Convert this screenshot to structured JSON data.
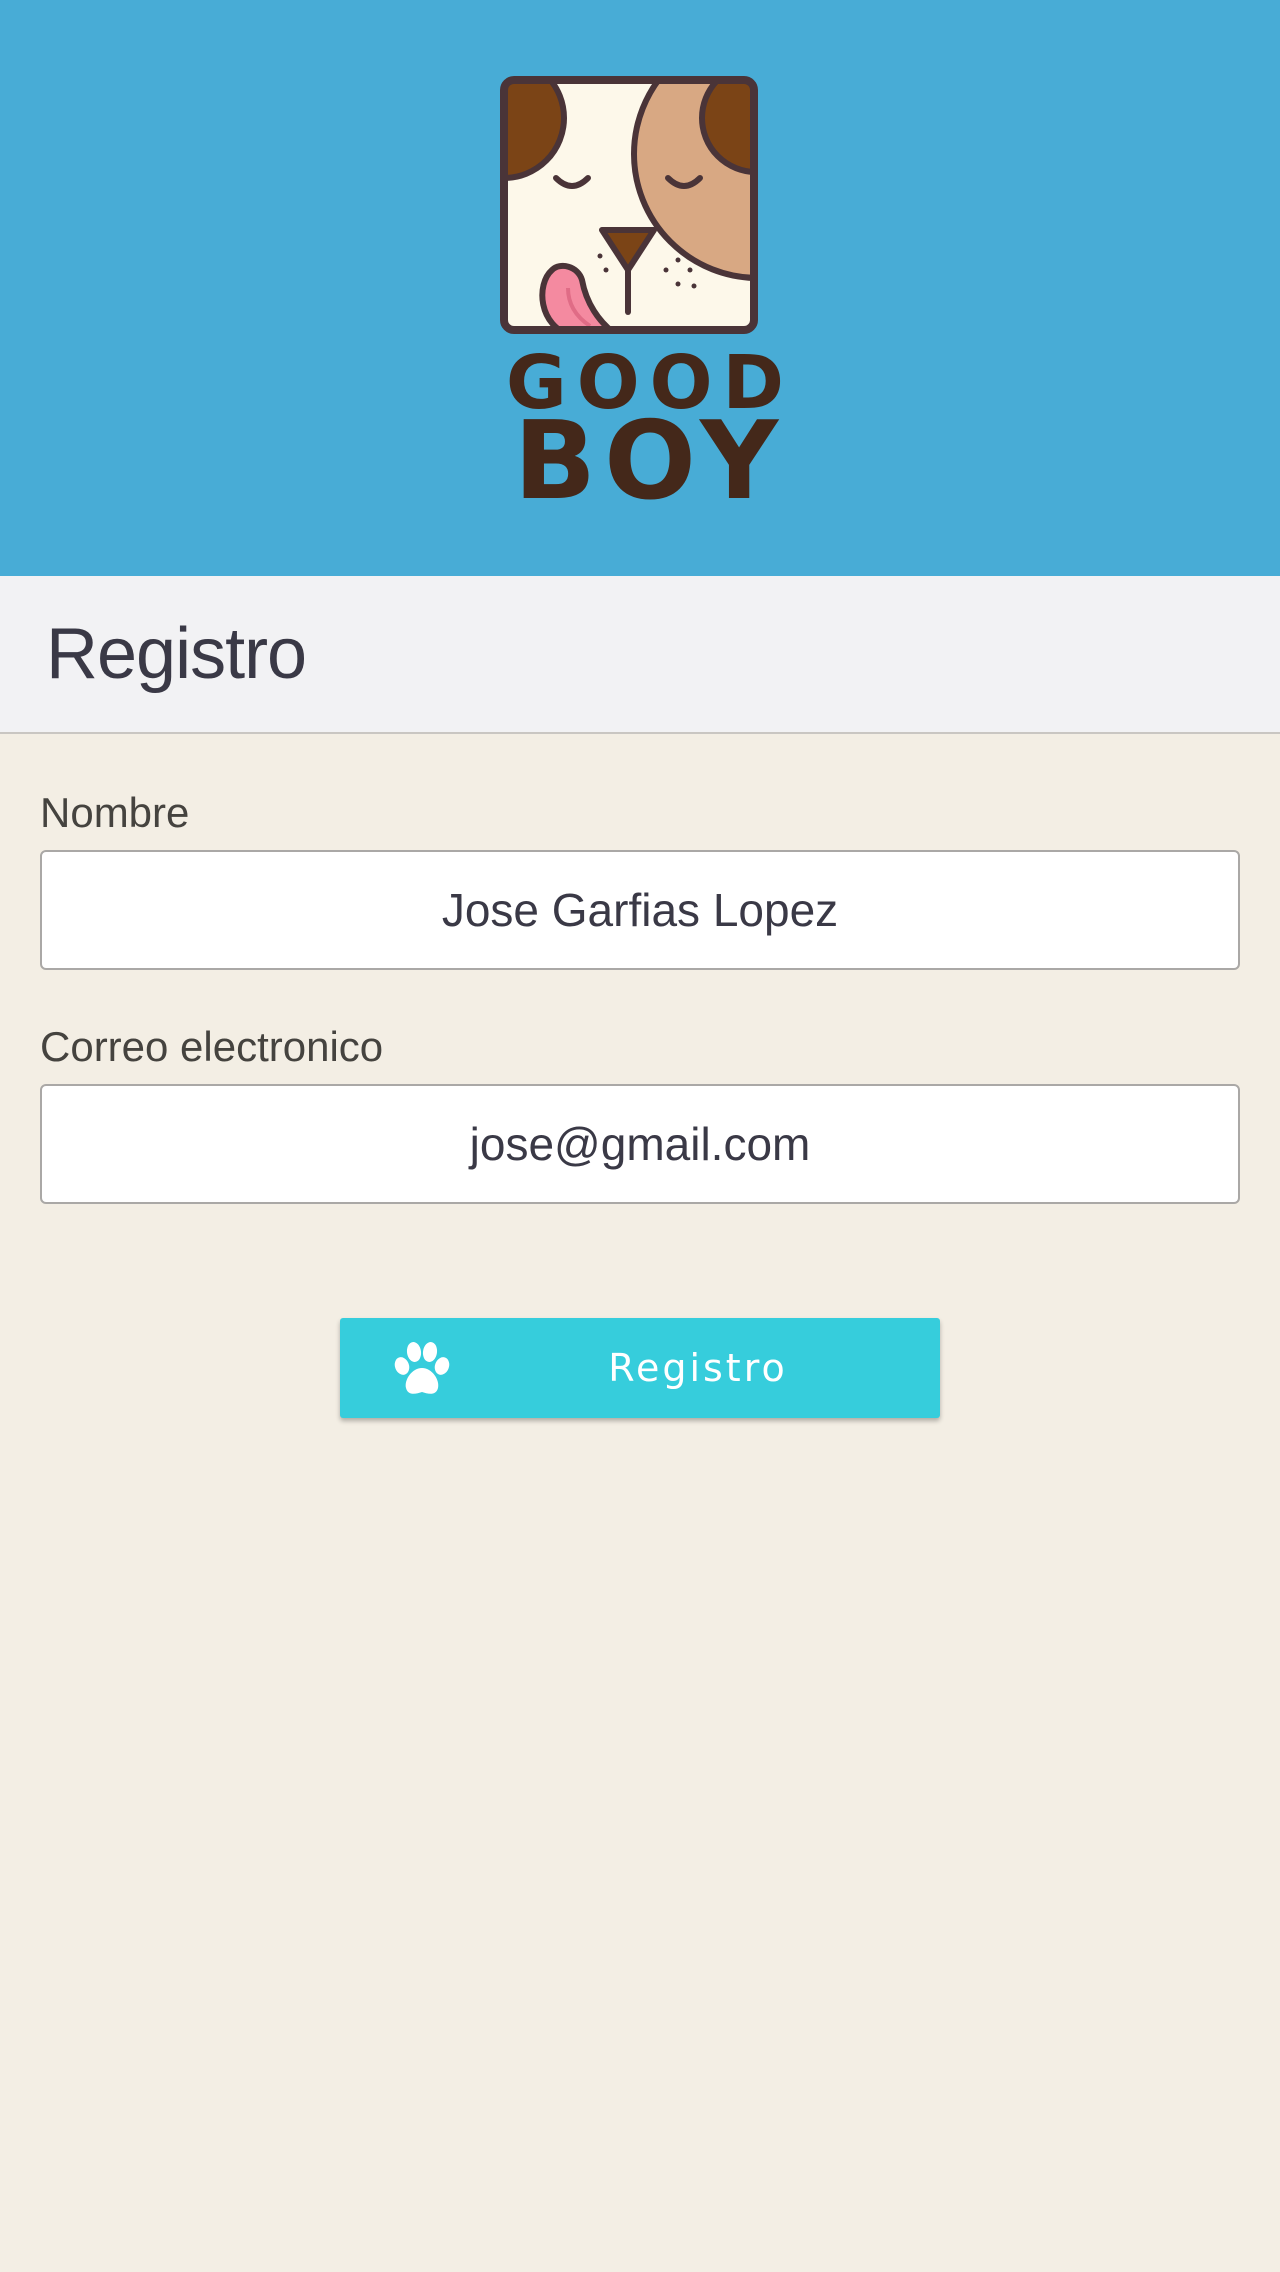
{
  "header": {
    "logo_line1": "GOOD",
    "logo_line2": "BOY",
    "background_color": "#48acd6",
    "logo_icon": "dog-face-icon"
  },
  "titlebar": {
    "title": "Registro"
  },
  "form": {
    "name_label": "Nombre",
    "name_value": "Jose Garfias Lopez",
    "email_label": "Correo electronico",
    "email_value": "jose@gmail.com",
    "submit_label": "Registro",
    "submit_icon": "paw-icon",
    "accent_color": "#36cddc"
  }
}
